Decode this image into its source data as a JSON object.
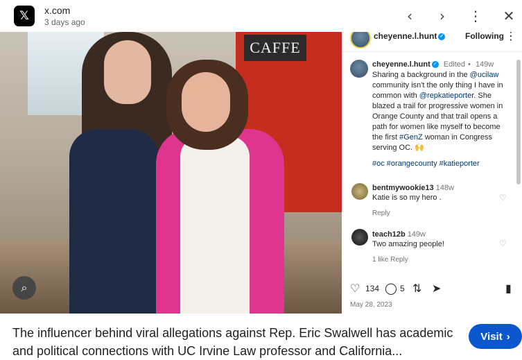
{
  "header": {
    "logo_glyph": "𝕏",
    "site_name": "x.com",
    "time_ago": "3 days ago",
    "icons": [
      "chevron-left-icon",
      "chevron-right-icon",
      "more-vert-icon",
      "close-icon"
    ]
  },
  "photo": {
    "cafe_sign": "CAFFE"
  },
  "instagram": {
    "username": "cheyenne.l.hunt",
    "follow_label": "Following",
    "caption": {
      "username": "cheyenne.l.hunt",
      "edited": "Edited",
      "age": "149w",
      "text_1": "Sharing a background in the ",
      "mention_1": "@ucilaw",
      "text_2": " community isn't the only thing I have in common with ",
      "mention_2": "@repkatieporter",
      "text_3": ". She blazed a trail for progressive women in Orange County and that trail opens a path for women like myself to become the first ",
      "mention_3": "#GenZ",
      "text_4": " woman in Congress serving OC. 🙌"
    },
    "hashtags": "#oc #orangecounty #katieporter",
    "comments": [
      {
        "username": "bentmywookie13",
        "age": "148w",
        "text": "Katie is so my hero .",
        "sub": "Reply"
      },
      {
        "username": "teach12b",
        "age": "149w",
        "text": "Two amazing people!",
        "sub": "1 like   Reply"
      }
    ],
    "actions": {
      "likes": "134",
      "comments": "5"
    },
    "date": "May 28, 2023"
  },
  "footer": {
    "headline": "The influencer behind viral allegations against Rep. Eric Swalwell has academic and political connections with UC Irvine Law professor and California...",
    "visit_label": "Visit",
    "accent": "#0b57d0"
  }
}
